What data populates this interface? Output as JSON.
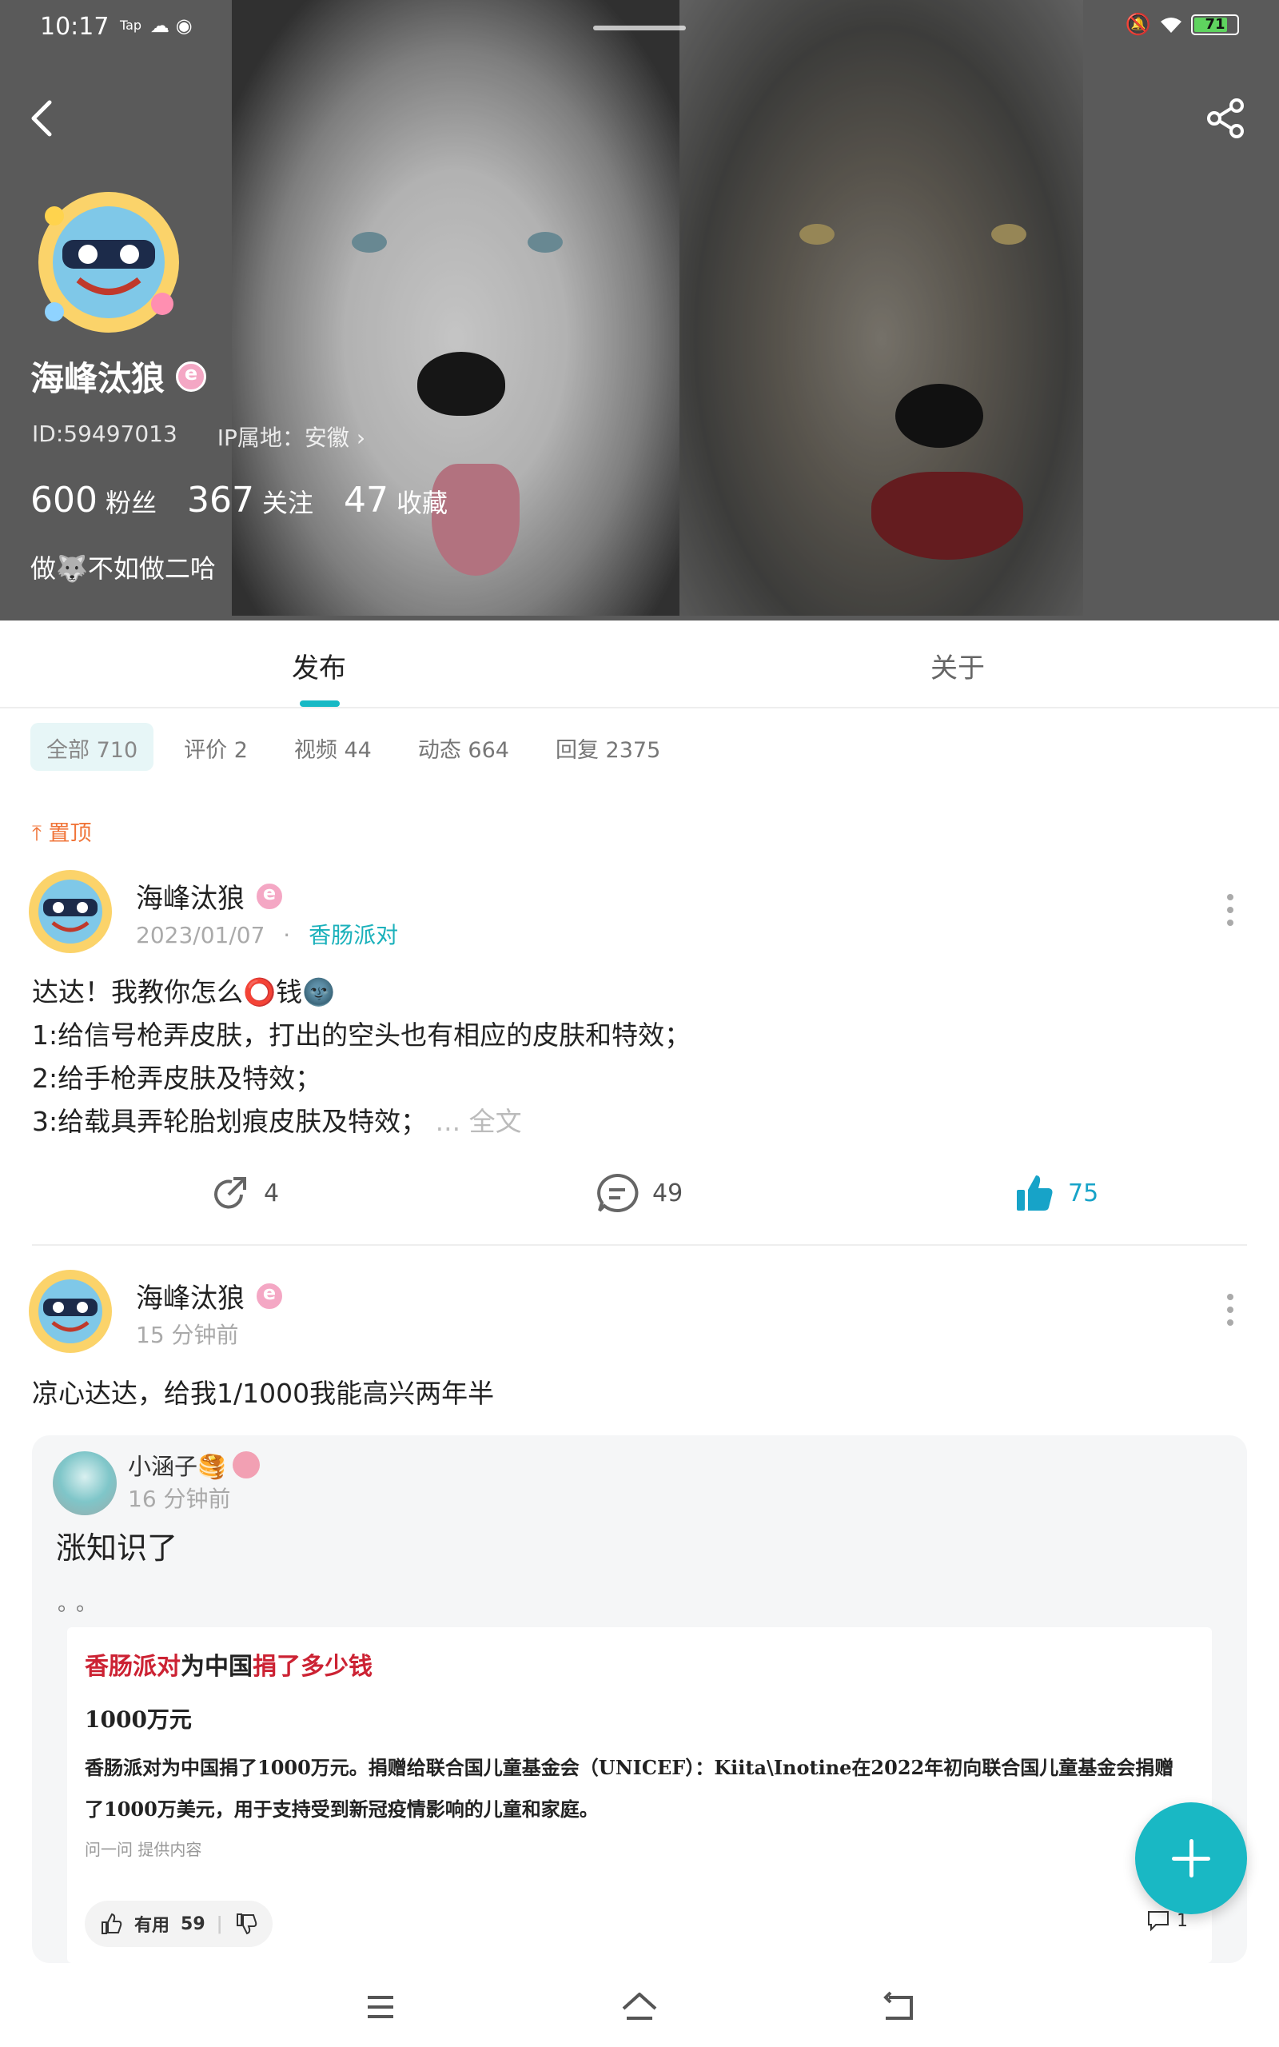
{
  "status_bar": {
    "time": "10:17",
    "tap_label": "Tap",
    "battery": "71"
  },
  "profile": {
    "username": "海峰汰狼",
    "id_text": "ID:59497013",
    "ip_text": "IP属地：安徽",
    "stats": [
      {
        "num": "600",
        "label": "粉丝"
      },
      {
        "num": "367",
        "label": "关注"
      },
      {
        "num": "47",
        "label": "收藏"
      }
    ],
    "bio": "做🐺不如做二哈"
  },
  "tabs": {
    "publish": "发布",
    "about": "关于"
  },
  "filters": [
    {
      "label": "全部 710"
    },
    {
      "label": "评价 2"
    },
    {
      "label": "视频 44"
    },
    {
      "label": "动态 664"
    },
    {
      "label": "回复 2375"
    }
  ],
  "pinned_label": "置顶",
  "post1": {
    "author": "海峰汰狼",
    "date": "2023/01/07",
    "category": "香肠派对",
    "lines": [
      "达达！我教你怎么⭕钱🌚",
      "1:给信号枪弄皮肤，打出的空头也有相应的皮肤和特效；",
      "2:给手枪弄皮肤及特效；",
      "3:给载具弄轮胎划痕皮肤及特效；"
    ],
    "read_more": "... 全文",
    "shares": "4",
    "comments": "49",
    "likes": "75"
  },
  "post2": {
    "author": "海峰汰狼",
    "time": "15 分钟前",
    "text": "凉心达达，给我1/1000我能高兴两年半",
    "reply": {
      "name": "小涵子🥞",
      "time": "16 分钟前",
      "text": "涨知识了",
      "dots": "。。",
      "embedded": {
        "title_red1": "香肠派对",
        "title_mid": "为中国",
        "title_red2": "捐了多少钱",
        "answer": "1000万元",
        "body": "香肠派对为中国捐了1000万元。捐赠给联合国儿童基金会（UNICEF）：Kiita\\Inotine在2022年初向联合国儿童基金会捐赠了1000万美元，用于支持受到新冠疫情影响的儿童和家庭。",
        "source": "问一问 提供内容",
        "useful_label": "有用",
        "useful_count": "59",
        "comment_count": "1"
      }
    }
  },
  "colors": {
    "accent": "#17b9c5",
    "pin": "#f0753a",
    "like": "#17a3c8"
  },
  "icons": [
    "back-icon",
    "share-icon",
    "more-icon",
    "repost-icon",
    "comment-icon",
    "like-icon",
    "plus-icon",
    "menu-icon",
    "home-icon",
    "back-nav-icon"
  ]
}
